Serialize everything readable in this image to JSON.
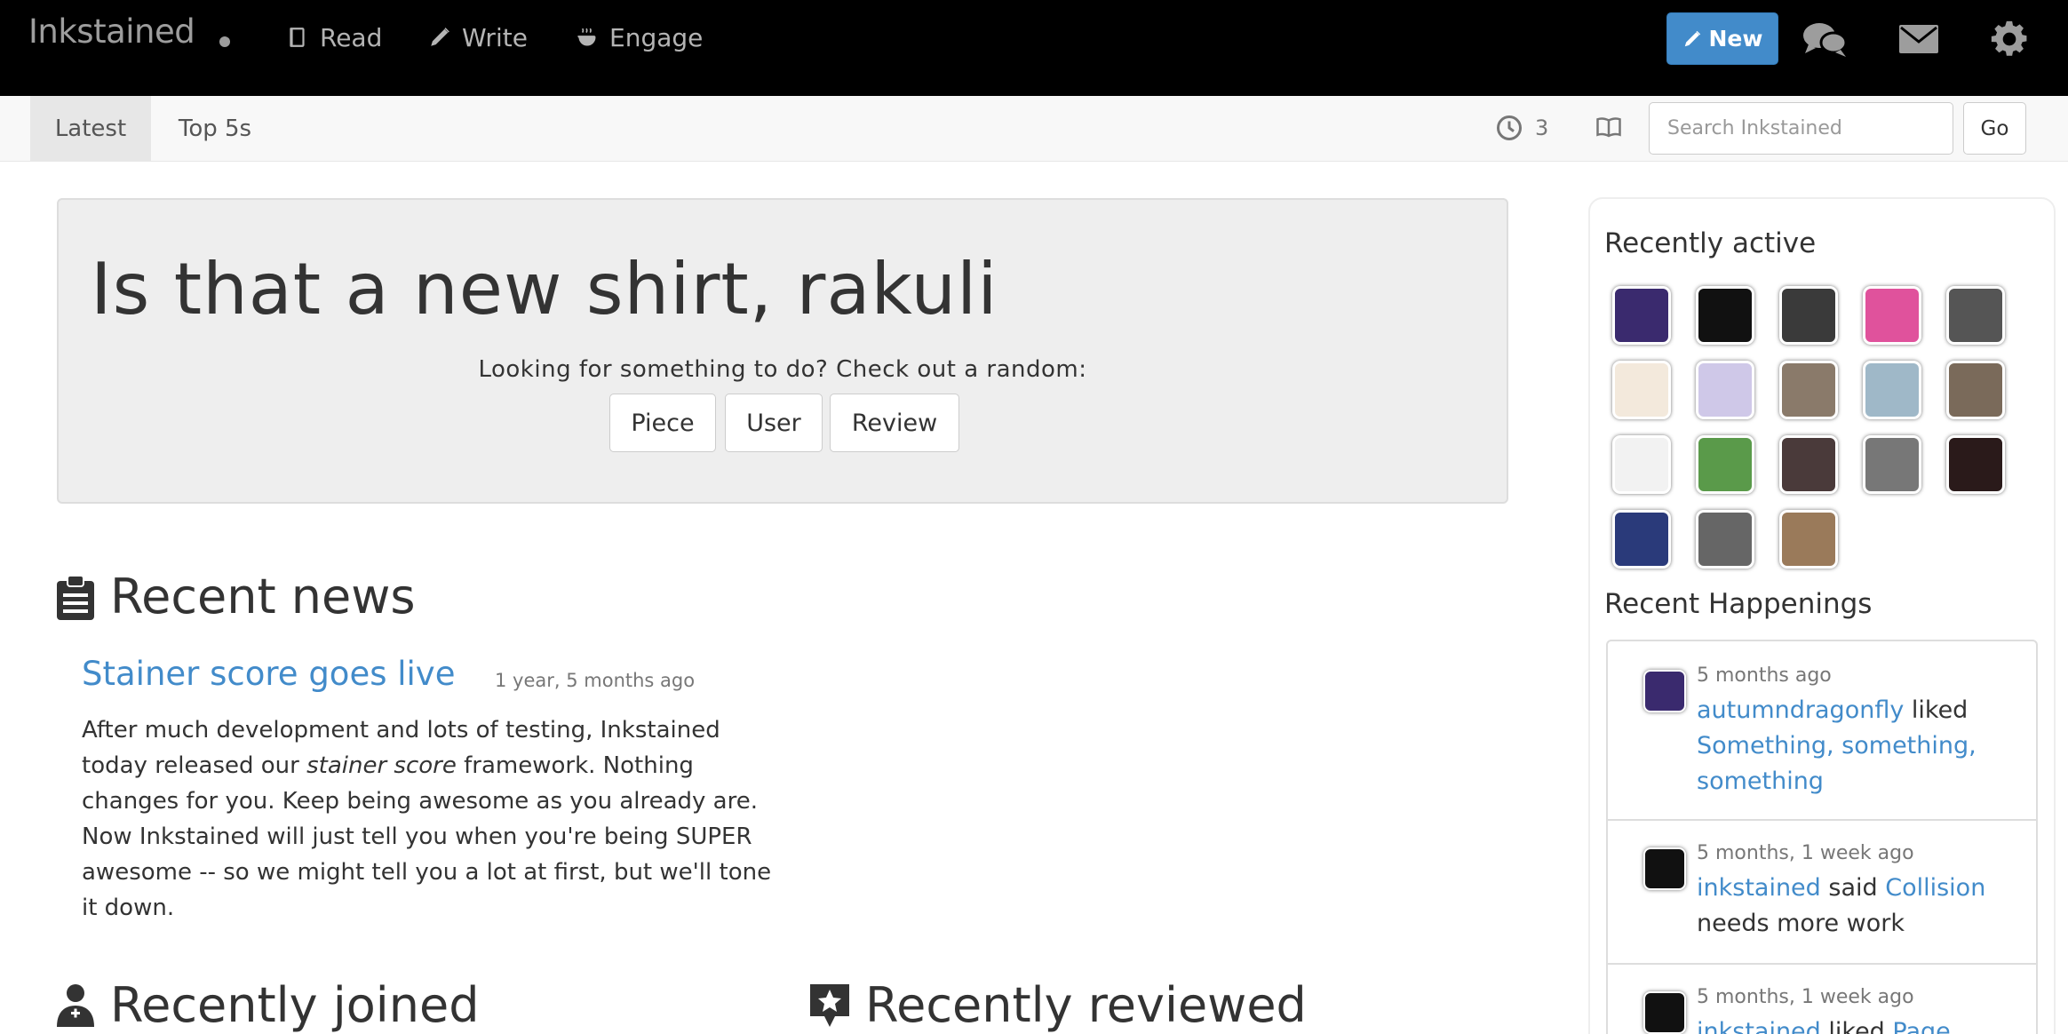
{
  "navbar": {
    "brand": "Inkstained",
    "links": [
      "Read",
      "Write",
      "Engage"
    ],
    "new_button": "New",
    "icons": [
      "chat-bubbles-icon",
      "envelope-icon",
      "gear-icon"
    ]
  },
  "subnav": {
    "tabs": [
      "Latest",
      "Top 5s"
    ],
    "active_tab": "Latest",
    "clock_count": "3",
    "search_placeholder": "Search Inkstained",
    "go_label": "Go"
  },
  "jumbotron": {
    "title": "Is that a new shirt, rakuli",
    "subtitle": "Looking for something to do? Check out a random:",
    "buttons": [
      "Piece",
      "User",
      "Review"
    ]
  },
  "recent_news": {
    "heading": "Recent news",
    "item": {
      "title": "Stainer score goes live",
      "time": "1 year, 5 months ago",
      "body_1": "After much development and lots of testing, Inkstained today released our ",
      "body_em": "stainer score",
      "body_2": " framework. Nothing changes for you. Keep being awesome as you already are. Now Inkstained will just tell you when you're being SUPER awesome -- so we might tell you a lot at first, but we'll tone it down."
    }
  },
  "recently_joined": {
    "heading": "Recently joined"
  },
  "recently_reviewed": {
    "heading": "Recently reviewed"
  },
  "sidebar": {
    "recently_active_title": "Recently active",
    "avatar_colors": [
      "#3a2a6e",
      "#111111",
      "#3a3a3a",
      "#e0529c",
      "#555555",
      "#f3e9dc",
      "#cfc8e8",
      "#8a7a6a",
      "#9fb8c8",
      "#7a6a5a",
      "#f2f2f2",
      "#5a9a4a",
      "#4a3a3a",
      "#777777",
      "#2a1a1a",
      "#2a3a7a",
      "#666666",
      "#9a7a5a"
    ],
    "recent_happenings_title": "Recent Happenings",
    "happenings": [
      {
        "time": "5 months ago",
        "user": "autumndragonfly",
        "verb": " liked ",
        "target": "Something, something, something",
        "tail": "",
        "avatar_color": "#3a2a6e"
      },
      {
        "time": "5 months, 1 week ago",
        "user": "inkstained",
        "verb": " said ",
        "target": "Collision",
        "tail": " needs more work",
        "avatar_color": "#111111"
      },
      {
        "time": "5 months, 1 week ago",
        "user": "inkstained",
        "verb": " liked ",
        "target": "Page",
        "tail": "",
        "avatar_color": "#111111"
      }
    ]
  }
}
